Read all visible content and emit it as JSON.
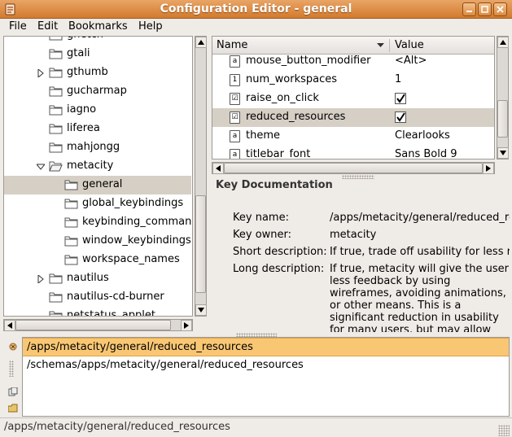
{
  "window": {
    "title": "Configuration Editor - general"
  },
  "menu": [
    "File",
    "Edit",
    "Bookmarks",
    "Help"
  ],
  "tree": [
    {
      "label": "gnetch",
      "indent": 2,
      "expander": "none",
      "open": false,
      "selected": false
    },
    {
      "label": "gtali",
      "indent": 2,
      "expander": "none",
      "open": false,
      "selected": false
    },
    {
      "label": "gthumb",
      "indent": 2,
      "expander": "collapsed",
      "open": false,
      "selected": false
    },
    {
      "label": "gucharmap",
      "indent": 2,
      "expander": "none",
      "open": false,
      "selected": false
    },
    {
      "label": "iagno",
      "indent": 2,
      "expander": "none",
      "open": false,
      "selected": false
    },
    {
      "label": "liferea",
      "indent": 2,
      "expander": "none",
      "open": false,
      "selected": false
    },
    {
      "label": "mahjongg",
      "indent": 2,
      "expander": "none",
      "open": false,
      "selected": false
    },
    {
      "label": "metacity",
      "indent": 2,
      "expander": "expanded",
      "open": true,
      "selected": false
    },
    {
      "label": "general",
      "indent": 3,
      "expander": "none",
      "open": false,
      "selected": true
    },
    {
      "label": "global_keybindings",
      "indent": 3,
      "expander": "none",
      "open": false,
      "selected": false
    },
    {
      "label": "keybinding_commands",
      "indent": 3,
      "expander": "none",
      "open": false,
      "selected": false
    },
    {
      "label": "window_keybindings",
      "indent": 3,
      "expander": "none",
      "open": false,
      "selected": false
    },
    {
      "label": "workspace_names",
      "indent": 3,
      "expander": "none",
      "open": false,
      "selected": false
    },
    {
      "label": "nautilus",
      "indent": 2,
      "expander": "collapsed",
      "open": false,
      "selected": false
    },
    {
      "label": "nautilus-cd-burner",
      "indent": 2,
      "expander": "none",
      "open": false,
      "selected": false
    },
    {
      "label": "netstatus_applet",
      "indent": 2,
      "expander": "none",
      "open": false,
      "selected": false
    }
  ],
  "keys": {
    "headers": {
      "name": "Name",
      "value": "Value"
    },
    "rows": [
      {
        "name": "mouse_button_modifier",
        "value": "<Alt>",
        "icon": "a",
        "type": "text",
        "selected": false
      },
      {
        "name": "num_workspaces",
        "value": "1",
        "icon": "1",
        "type": "text",
        "selected": false
      },
      {
        "name": "raise_on_click",
        "value": "",
        "icon": "☑",
        "type": "bool",
        "selected": false
      },
      {
        "name": "reduced_resources",
        "value": "",
        "icon": "☑",
        "type": "bool",
        "selected": true
      },
      {
        "name": "theme",
        "value": "Clearlooks",
        "icon": "a",
        "type": "text",
        "selected": false
      },
      {
        "name": "titlebar_font",
        "value": "Sans Bold 9",
        "icon": "a",
        "type": "text",
        "selected": false
      }
    ]
  },
  "doc": {
    "title": "Key Documentation",
    "key_name_label": "Key name:",
    "key_name": "/apps/metacity/general/reduced_resources",
    "key_owner_label": "Key owner:",
    "key_owner": "metacity",
    "short_label": "Short description:",
    "short": "If true, trade off usability for less resource usage",
    "long_label": "Long description:",
    "long": "If true, metacity will give the user less feedback by using wireframes, avoiding animations, or other means. This is a significant reduction in usability for many users, but may allow legacy applications to continue working, and may also be"
  },
  "results": [
    {
      "text": "/apps/metacity/general/reduced_resources",
      "selected": true
    },
    {
      "text": "/schemas/apps/metacity/general/reduced_resources",
      "selected": false
    }
  ],
  "status": "/apps/metacity/general/reduced_resources",
  "colors": {
    "titlebar": "#d27a2e",
    "selection": "#d6cfc5",
    "result_highlight": "#f9c774"
  }
}
